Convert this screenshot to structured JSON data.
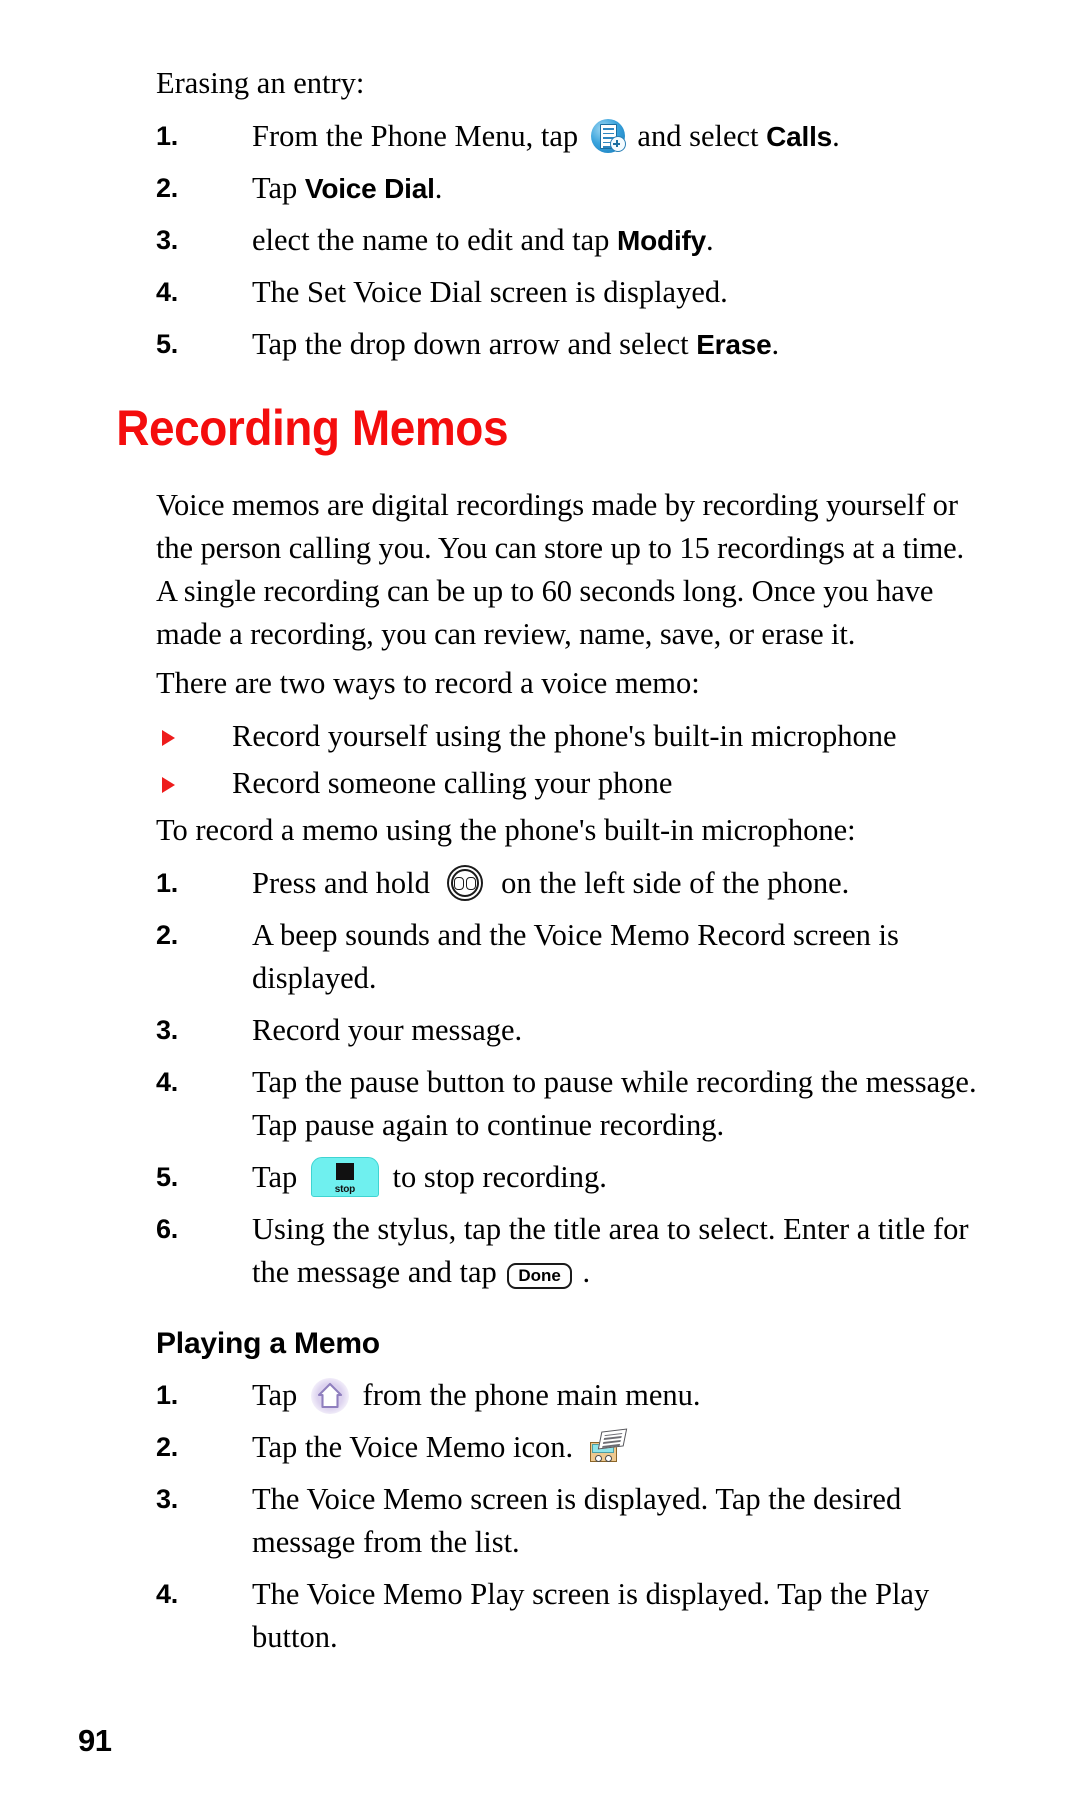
{
  "document": {
    "page_number": "91",
    "accent_color": "#f40d0d",
    "heading": "Recording Memos",
    "subheading": "Playing a Memo"
  },
  "erasing_section": {
    "lead": "Erasing an entry:",
    "steps": [
      {
        "num": "1.",
        "before": "From the Phone Menu, tap",
        "icon": "calls-list-icon",
        "after": "and select",
        "bold": "Calls",
        "tail": "."
      },
      {
        "num": "2.",
        "before": "Tap",
        "bold": "Voice Dial",
        "tail": "."
      },
      {
        "num": "3.",
        "before": "elect the name to edit and tap",
        "bold": "Modify",
        "tail": "."
      },
      {
        "num": "4.",
        "before": "The Set Voice Dial screen is displayed."
      },
      {
        "num": "5.",
        "before": "Tap the drop down arrow and select",
        "bold": "Erase",
        "tail": "."
      }
    ]
  },
  "recording_memos": {
    "intro": "Voice memos are digital recordings made by recording yourself or the person calling you. You can store up to 15 recordings at a time. A single recording can be up to 60 seconds long. Once you have made a recording, you can review, name, save, or erase it.",
    "ways_lead": "There are two ways to record a voice memo:",
    "bullets": [
      "Record yourself using the phone's built-in microphone",
      "Record someone calling your phone"
    ],
    "record_lead": "To record a memo using the phone's built-in microphone:",
    "steps": [
      {
        "num": "1.",
        "before": "Press and hold",
        "icon": "side-record-key-icon",
        "after": "on the left side of the phone."
      },
      {
        "num": "2.",
        "before": "A beep sounds and the Voice Memo Record screen is displayed."
      },
      {
        "num": "3.",
        "before": "Record your message."
      },
      {
        "num": "4.",
        "before": "Tap the pause button to pause while recording the message. Tap pause again to continue recording."
      },
      {
        "num": "5.",
        "before": "Tap",
        "icon": "stop-button-icon",
        "icon_label": "stop",
        "after": "to stop recording."
      },
      {
        "num": "6.",
        "before": "Using the stylus, tap the title area to select. Enter a title for the message and tap",
        "icon": "done-button-icon",
        "icon_label": "Done",
        "after": "."
      }
    ]
  },
  "playing_memo": {
    "steps": [
      {
        "num": "1.",
        "before": "Tap",
        "icon": "home-icon",
        "after": "from the phone main menu."
      },
      {
        "num": "2.",
        "before": "Tap the Voice Memo icon.",
        "icon": "voice-memo-icon"
      },
      {
        "num": "3.",
        "before": "The Voice Memo screen is displayed. Tap the desired message from the list."
      },
      {
        "num": "4.",
        "before": "The Voice Memo Play screen is displayed. Tap the Play button."
      }
    ]
  }
}
